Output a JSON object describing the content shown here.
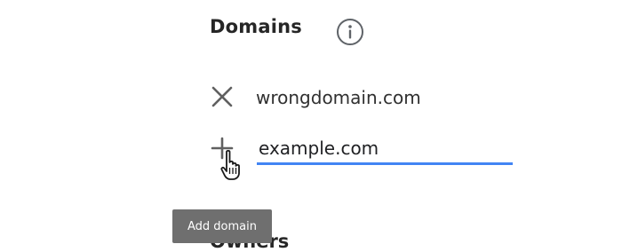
{
  "domains": {
    "title": "Domains",
    "info_icon": "info-circle-icon",
    "entries": [
      {
        "value": "wrongdomain.com",
        "action_icon": "close-icon"
      }
    ],
    "new_entry": {
      "value": "example.com",
      "action_icon": "plus-icon",
      "tooltip": "Add domain"
    }
  },
  "owners": {
    "title": "Owners"
  },
  "colors": {
    "accent": "#4285f4",
    "tooltip_bg": "#6f6f6f"
  }
}
